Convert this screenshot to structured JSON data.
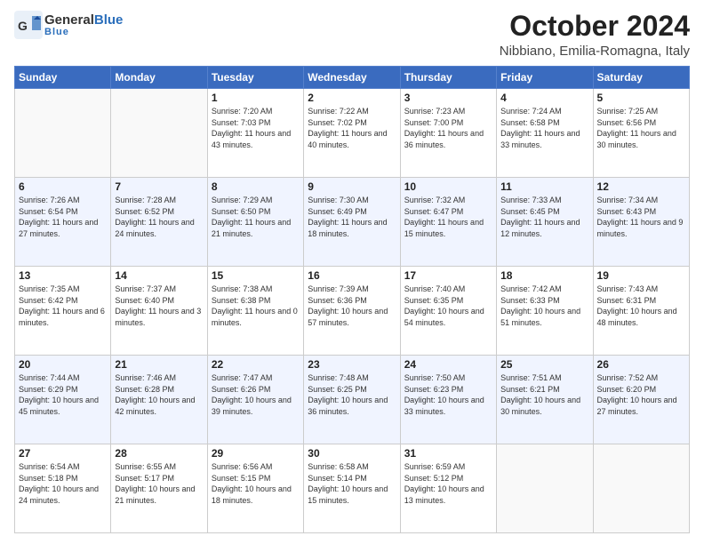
{
  "header": {
    "logo_general": "General",
    "logo_blue": "Blue",
    "month_title": "October 2024",
    "location": "Nibbiano, Emilia-Romagna, Italy"
  },
  "weekdays": [
    "Sunday",
    "Monday",
    "Tuesday",
    "Wednesday",
    "Thursday",
    "Friday",
    "Saturday"
  ],
  "weeks": [
    [
      {
        "day": "",
        "info": ""
      },
      {
        "day": "",
        "info": ""
      },
      {
        "day": "1",
        "info": "Sunrise: 7:20 AM\nSunset: 7:03 PM\nDaylight: 11 hours and 43 minutes."
      },
      {
        "day": "2",
        "info": "Sunrise: 7:22 AM\nSunset: 7:02 PM\nDaylight: 11 hours and 40 minutes."
      },
      {
        "day": "3",
        "info": "Sunrise: 7:23 AM\nSunset: 7:00 PM\nDaylight: 11 hours and 36 minutes."
      },
      {
        "day": "4",
        "info": "Sunrise: 7:24 AM\nSunset: 6:58 PM\nDaylight: 11 hours and 33 minutes."
      },
      {
        "day": "5",
        "info": "Sunrise: 7:25 AM\nSunset: 6:56 PM\nDaylight: 11 hours and 30 minutes."
      }
    ],
    [
      {
        "day": "6",
        "info": "Sunrise: 7:26 AM\nSunset: 6:54 PM\nDaylight: 11 hours and 27 minutes."
      },
      {
        "day": "7",
        "info": "Sunrise: 7:28 AM\nSunset: 6:52 PM\nDaylight: 11 hours and 24 minutes."
      },
      {
        "day": "8",
        "info": "Sunrise: 7:29 AM\nSunset: 6:50 PM\nDaylight: 11 hours and 21 minutes."
      },
      {
        "day": "9",
        "info": "Sunrise: 7:30 AM\nSunset: 6:49 PM\nDaylight: 11 hours and 18 minutes."
      },
      {
        "day": "10",
        "info": "Sunrise: 7:32 AM\nSunset: 6:47 PM\nDaylight: 11 hours and 15 minutes."
      },
      {
        "day": "11",
        "info": "Sunrise: 7:33 AM\nSunset: 6:45 PM\nDaylight: 11 hours and 12 minutes."
      },
      {
        "day": "12",
        "info": "Sunrise: 7:34 AM\nSunset: 6:43 PM\nDaylight: 11 hours and 9 minutes."
      }
    ],
    [
      {
        "day": "13",
        "info": "Sunrise: 7:35 AM\nSunset: 6:42 PM\nDaylight: 11 hours and 6 minutes."
      },
      {
        "day": "14",
        "info": "Sunrise: 7:37 AM\nSunset: 6:40 PM\nDaylight: 11 hours and 3 minutes."
      },
      {
        "day": "15",
        "info": "Sunrise: 7:38 AM\nSunset: 6:38 PM\nDaylight: 11 hours and 0 minutes."
      },
      {
        "day": "16",
        "info": "Sunrise: 7:39 AM\nSunset: 6:36 PM\nDaylight: 10 hours and 57 minutes."
      },
      {
        "day": "17",
        "info": "Sunrise: 7:40 AM\nSunset: 6:35 PM\nDaylight: 10 hours and 54 minutes."
      },
      {
        "day": "18",
        "info": "Sunrise: 7:42 AM\nSunset: 6:33 PM\nDaylight: 10 hours and 51 minutes."
      },
      {
        "day": "19",
        "info": "Sunrise: 7:43 AM\nSunset: 6:31 PM\nDaylight: 10 hours and 48 minutes."
      }
    ],
    [
      {
        "day": "20",
        "info": "Sunrise: 7:44 AM\nSunset: 6:29 PM\nDaylight: 10 hours and 45 minutes."
      },
      {
        "day": "21",
        "info": "Sunrise: 7:46 AM\nSunset: 6:28 PM\nDaylight: 10 hours and 42 minutes."
      },
      {
        "day": "22",
        "info": "Sunrise: 7:47 AM\nSunset: 6:26 PM\nDaylight: 10 hours and 39 minutes."
      },
      {
        "day": "23",
        "info": "Sunrise: 7:48 AM\nSunset: 6:25 PM\nDaylight: 10 hours and 36 minutes."
      },
      {
        "day": "24",
        "info": "Sunrise: 7:50 AM\nSunset: 6:23 PM\nDaylight: 10 hours and 33 minutes."
      },
      {
        "day": "25",
        "info": "Sunrise: 7:51 AM\nSunset: 6:21 PM\nDaylight: 10 hours and 30 minutes."
      },
      {
        "day": "26",
        "info": "Sunrise: 7:52 AM\nSunset: 6:20 PM\nDaylight: 10 hours and 27 minutes."
      }
    ],
    [
      {
        "day": "27",
        "info": "Sunrise: 6:54 AM\nSunset: 5:18 PM\nDaylight: 10 hours and 24 minutes."
      },
      {
        "day": "28",
        "info": "Sunrise: 6:55 AM\nSunset: 5:17 PM\nDaylight: 10 hours and 21 minutes."
      },
      {
        "day": "29",
        "info": "Sunrise: 6:56 AM\nSunset: 5:15 PM\nDaylight: 10 hours and 18 minutes."
      },
      {
        "day": "30",
        "info": "Sunrise: 6:58 AM\nSunset: 5:14 PM\nDaylight: 10 hours and 15 minutes."
      },
      {
        "day": "31",
        "info": "Sunrise: 6:59 AM\nSunset: 5:12 PM\nDaylight: 10 hours and 13 minutes."
      },
      {
        "day": "",
        "info": ""
      },
      {
        "day": "",
        "info": ""
      }
    ]
  ]
}
